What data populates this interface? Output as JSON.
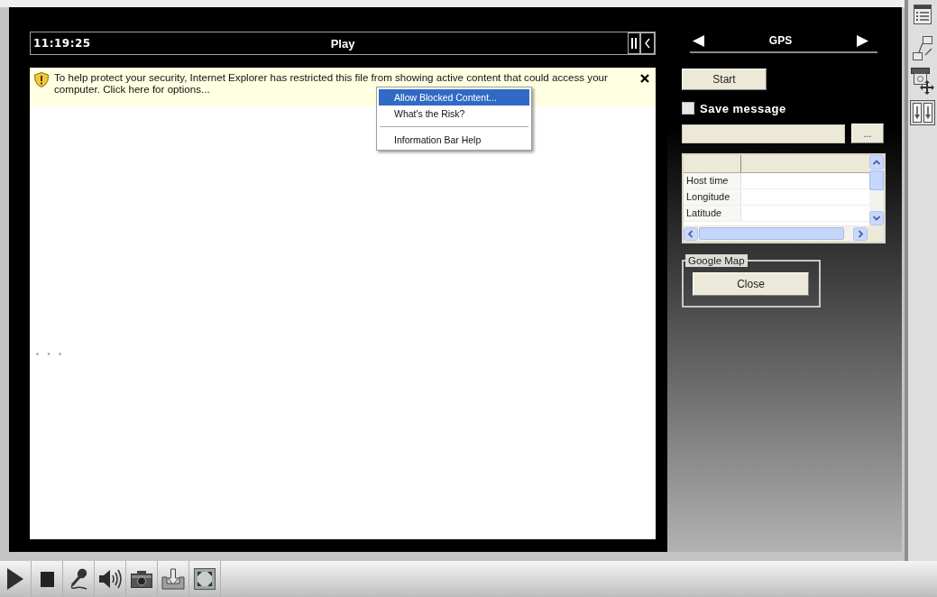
{
  "player": {
    "time": "11:19:25",
    "status": "Play"
  },
  "info_bar": {
    "message": "To help protect your security, Internet Explorer has restricted this file from showing active content that could access your computer. Click here for options..."
  },
  "context_menu": {
    "groups": [
      {
        "items": [
          {
            "label": "Allow Blocked Content...",
            "selected": true
          },
          {
            "label": "What's the Risk?",
            "selected": false
          }
        ]
      },
      {
        "items": [
          {
            "label": "Information Bar Help",
            "selected": false
          }
        ]
      }
    ]
  },
  "gps_panel": {
    "title": "GPS",
    "start_button": "Start",
    "save_message": {
      "label": "Save message",
      "checked": false
    },
    "browse_button": "...",
    "table": {
      "rows": [
        "Host time",
        "Longitude",
        "Latitude"
      ]
    },
    "google_map": {
      "title": "Google Map",
      "close_button": "Close"
    }
  }
}
